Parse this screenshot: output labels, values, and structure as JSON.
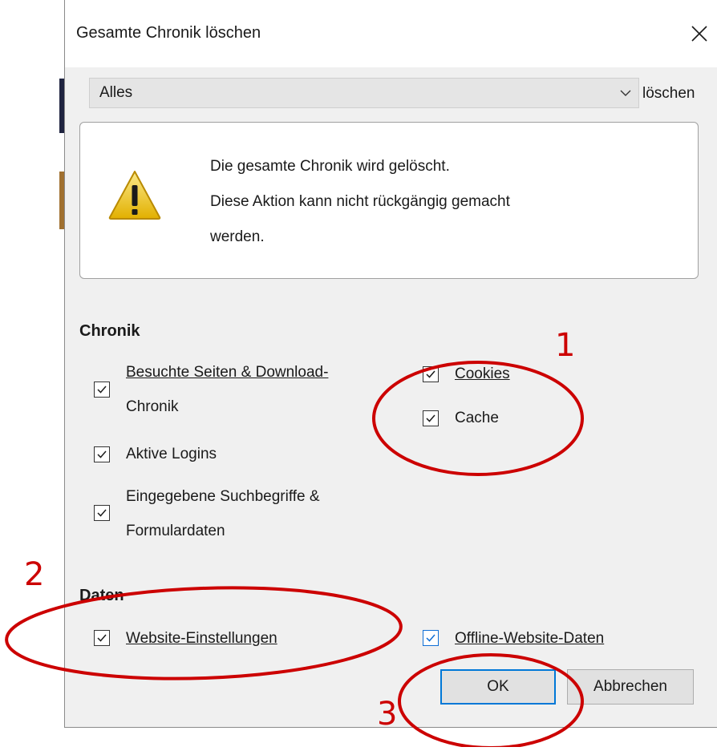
{
  "dialog": {
    "title": "Gesamte Chronik löschen",
    "close_glyph": "✕",
    "range": {
      "selected": "Alles",
      "suffix": "löschen"
    },
    "warning": {
      "line1": "Die gesamte Chronik wird gelöscht.",
      "line2": "Diese Aktion kann nicht rückgängig gemacht",
      "line3": "werden."
    },
    "history_section": {
      "heading": "Chronik",
      "visited_line1": "Besuchte Seiten & Download-",
      "visited_line2": "Chronik",
      "cookies": "Cookies",
      "cache": "Cache",
      "logins": "Aktive Logins",
      "forms_line1": "Eingegebene Suchbegriffe &",
      "forms_line2": "Formulardaten"
    },
    "data_section": {
      "heading": "Daten",
      "site_settings": "Website-Einstellungen",
      "offline_data": "Offline-Website-Daten"
    },
    "buttons": {
      "ok": "OK",
      "cancel": "Abbrechen"
    }
  },
  "annotations": [
    "1",
    "2",
    "3"
  ],
  "colors": {
    "annotation": "#cc0000",
    "focus": "#0078d7"
  }
}
